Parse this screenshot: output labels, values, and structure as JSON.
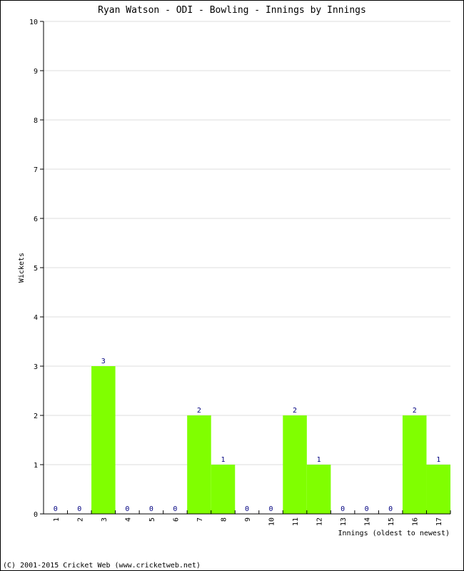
{
  "chart_data": {
    "type": "bar",
    "title": "Ryan Watson - ODI - Bowling - Innings by Innings",
    "xlabel": "Innings (oldest to newest)",
    "ylabel": "Wickets",
    "categories": [
      "1",
      "2",
      "3",
      "4",
      "5",
      "6",
      "7",
      "8",
      "9",
      "10",
      "11",
      "12",
      "13",
      "14",
      "15",
      "16",
      "17"
    ],
    "values": [
      0,
      0,
      3,
      0,
      0,
      0,
      2,
      1,
      0,
      0,
      2,
      1,
      0,
      0,
      0,
      2,
      1
    ],
    "ylim": [
      0,
      10
    ],
    "yticks": [
      0,
      1,
      2,
      3,
      4,
      5,
      6,
      7,
      8,
      9,
      10
    ],
    "grid": true,
    "bar_color": "#80ff00",
    "label_color": "#000080"
  },
  "footer": "(C) 2001-2015 Cricket Web (www.cricketweb.net)"
}
